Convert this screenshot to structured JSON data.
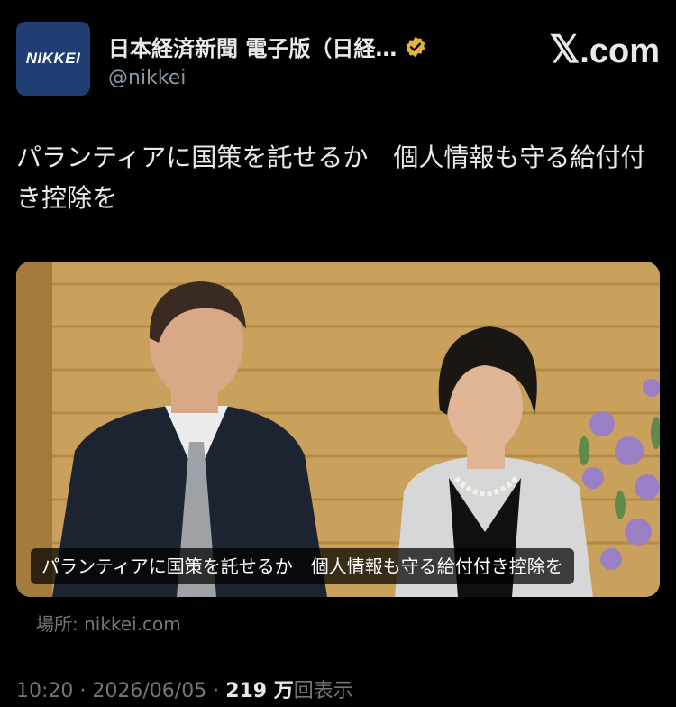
{
  "account": {
    "avatar_text": "NIKKEI",
    "display_name": "日本経済新聞 電子版（日経…",
    "handle": "@nikkei",
    "verified_icon": "verified-badge-icon",
    "brand_color": "#1f3f74",
    "verified_color": "#e3b33b"
  },
  "platform": {
    "logo_x": "𝕏",
    "logo_suffix": ".com"
  },
  "tweet": {
    "text": "パランティアに国策を託せるか　個人情報も守る給付付き控除を"
  },
  "card": {
    "caption": "パランティアに国策を託せるか　個人情報も守る給付付き控除を",
    "source_prefix": "場所: ",
    "source_domain": "nikkei.com"
  },
  "meta": {
    "time": "10:20",
    "date": "2026/06/05",
    "separator": " · ",
    "views_count": "219 万",
    "views_label": "回表示"
  }
}
